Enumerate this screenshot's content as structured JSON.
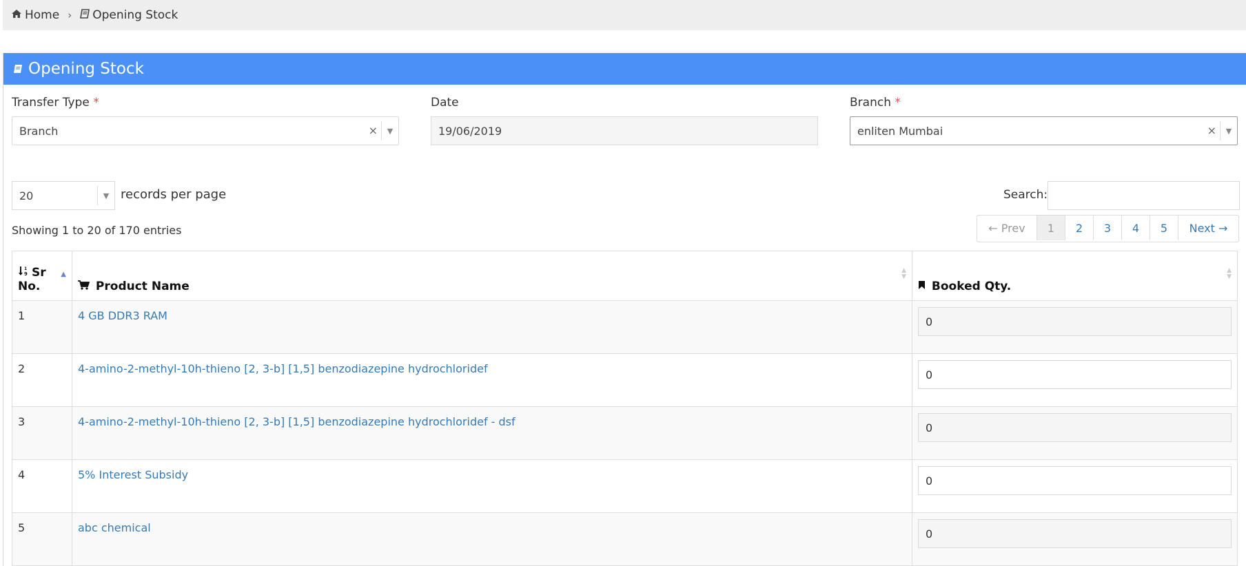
{
  "breadcrumb": {
    "home_label": "Home",
    "current_label": "Opening Stock",
    "separator": "›"
  },
  "panel": {
    "title": "Opening Stock",
    "header_color": "#4a90f7"
  },
  "form": {
    "transfer_type": {
      "label": "Transfer Type",
      "required_mark": "*",
      "value": "Branch",
      "clear": "×",
      "arrow": "▼"
    },
    "date": {
      "label": "Date",
      "value": "19/06/2019"
    },
    "branch": {
      "label": "Branch",
      "required_mark": "*",
      "value": "enliten Mumbai",
      "clear": "×",
      "arrow": "▼"
    }
  },
  "table_controls": {
    "page_length_value": "20",
    "page_length_arrow": "▼",
    "page_length_label": "records per page",
    "search_label": "Search:",
    "search_value": "",
    "info": "Showing 1 to 20 of 170 entries"
  },
  "pagination": {
    "prev": "← Prev",
    "pages": [
      "1",
      "2",
      "3",
      "4",
      "5"
    ],
    "next": "Next →",
    "active_page": "1"
  },
  "table": {
    "columns": {
      "sr_line1": "Sr",
      "sr_line2": "No.",
      "product": "Product Name",
      "booked": "Booked Qty."
    },
    "rows": [
      {
        "sr": "1",
        "product": "4 GB DDR3 RAM",
        "qty": "0"
      },
      {
        "sr": "2",
        "product": "4-amino-2-methyl-10h-thieno [2, 3-b] [1,5] benzodiazepine hydrochloridef",
        "qty": "0"
      },
      {
        "sr": "3",
        "product": "4-amino-2-methyl-10h-thieno [2, 3-b] [1,5] benzodiazepine hydrochloridef - dsf",
        "qty": "0"
      },
      {
        "sr": "4",
        "product": "5% Interest Subsidy",
        "qty": "0"
      },
      {
        "sr": "5",
        "product": "abc chemical",
        "qty": "0"
      }
    ]
  },
  "icons": {
    "home": "home-icon",
    "book": "book-icon",
    "sort_numeric": "sort-numeric-icon",
    "cart": "cart-icon",
    "bookmark": "bookmark-icon"
  }
}
